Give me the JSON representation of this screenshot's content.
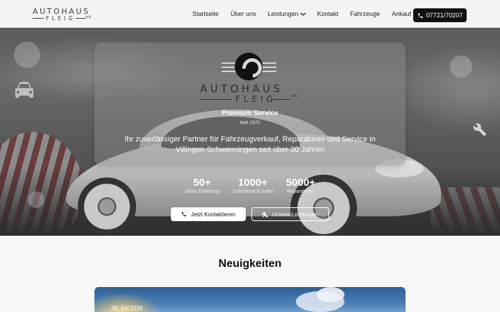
{
  "header": {
    "logo_top": "AUTOHAUS",
    "logo_bottom": "FLEIG",
    "logo_suffix": "e.K.",
    "nav": [
      {
        "label": "Startseite"
      },
      {
        "label": "Über uns"
      },
      {
        "label": "Leistungen"
      },
      {
        "label": "Kontakt"
      },
      {
        "label": "Fahrzeuge"
      },
      {
        "label": "Ankauf"
      }
    ],
    "phone": "07721/70207"
  },
  "hero": {
    "logo_top": "AUTOHAUS",
    "logo_bottom": "FLEIG",
    "logo_suffix": "e.K.",
    "title": "Premium Service",
    "since": "Seit 1971",
    "description": "Ihr zuverlässiger Partner für Fahrzeugverkauf, Reparaturen und Service in Villingen-Schwenningen seit über 30 Jahren",
    "stats": [
      {
        "value": "50+",
        "label": "Jahre Erfahrung"
      },
      {
        "value": "1000+",
        "label": "Zufriedene Kunden"
      },
      {
        "value": "5000+",
        "label": "Reparaturen"
      }
    ],
    "cta_primary": "Jetzt Kontaktieren",
    "cta_secondary": "Unsere Leistungen"
  },
  "news": {
    "heading": "Neuigkeiten",
    "items": [
      {
        "date": "28. Juli 2026"
      }
    ]
  },
  "icons": {
    "phone": "phone-icon",
    "tools": "tools-icon",
    "car": "car-icon",
    "chevron": "chevron-down-icon"
  }
}
